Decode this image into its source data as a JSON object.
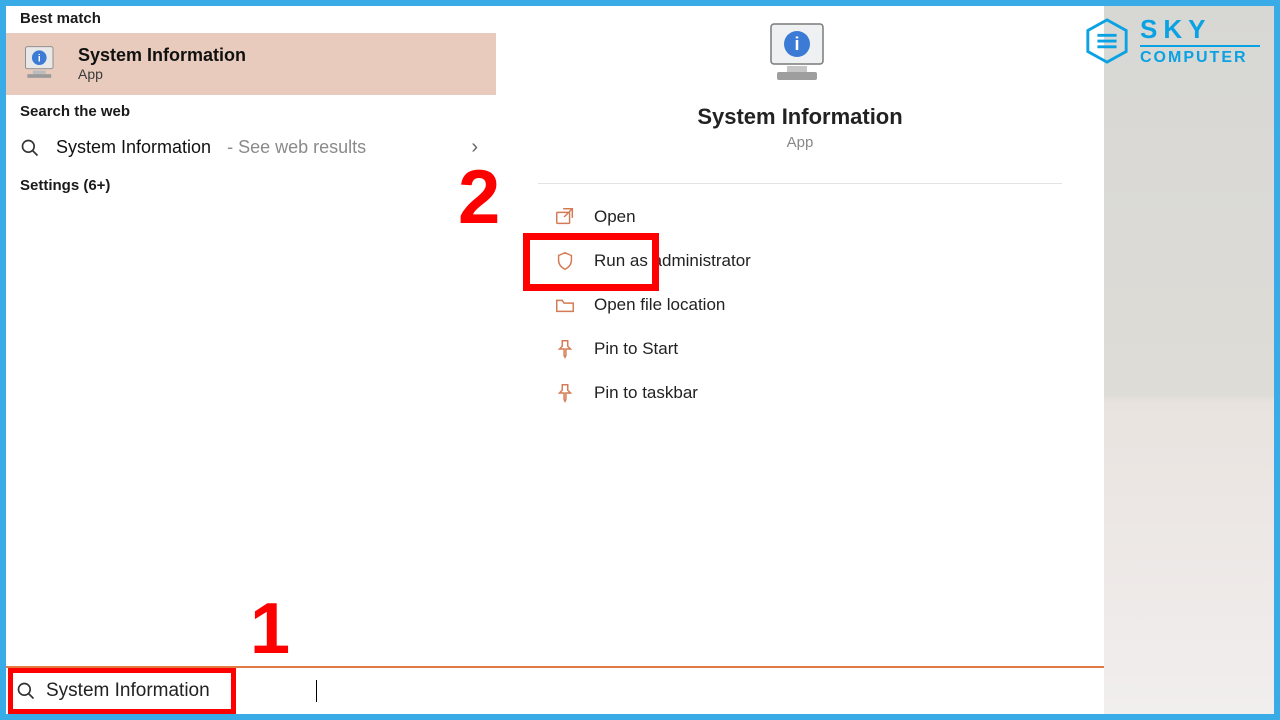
{
  "left": {
    "best_match_label": "Best match",
    "best_match": {
      "title": "System Information",
      "subtitle": "App"
    },
    "web_label": "Search the web",
    "web_item": {
      "query": "System Information",
      "hint": "See web results"
    },
    "settings_label": "Settings (6+)"
  },
  "preview": {
    "title": "System Information",
    "subtitle": "App",
    "actions": [
      {
        "label": "Open"
      },
      {
        "label": "Run as administrator"
      },
      {
        "label": "Open file location"
      },
      {
        "label": "Pin to Start"
      },
      {
        "label": "Pin to taskbar"
      }
    ]
  },
  "search": {
    "value": "System Information"
  },
  "annotations": {
    "one": "1",
    "two": "2"
  },
  "brand": {
    "line1": "SKY",
    "line2": "COMPUTER"
  }
}
